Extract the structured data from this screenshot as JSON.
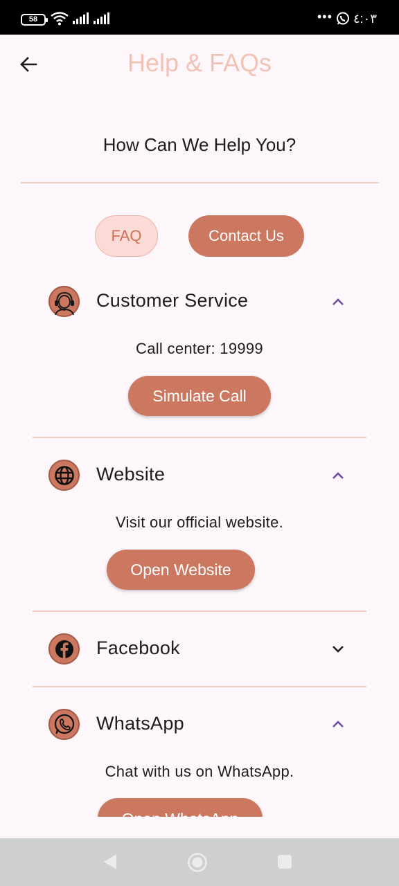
{
  "status_bar": {
    "battery": "58",
    "time": "٤:٠٣",
    "more": "•••"
  },
  "app_bar": {
    "title": "Help & FAQs"
  },
  "heading": "How Can We Help You?",
  "tabs": [
    {
      "label": "FAQ"
    },
    {
      "label": "Contact Us"
    }
  ],
  "sections": {
    "customer_service": {
      "title": "Customer Service",
      "description": "Call center: 19999",
      "button": "Simulate Call"
    },
    "website": {
      "title": "Website",
      "description": "Visit our official website.",
      "button": "Open Website"
    },
    "facebook": {
      "title": "Facebook"
    },
    "whatsapp": {
      "title": "WhatsApp",
      "description": "Chat with us on WhatsApp.",
      "button": "Open WhatsApp"
    }
  },
  "colors": {
    "accent": "#cc7760",
    "title": "#f2c2b4",
    "background": "#fdf6fb",
    "chevron": "#6b4fa0"
  }
}
